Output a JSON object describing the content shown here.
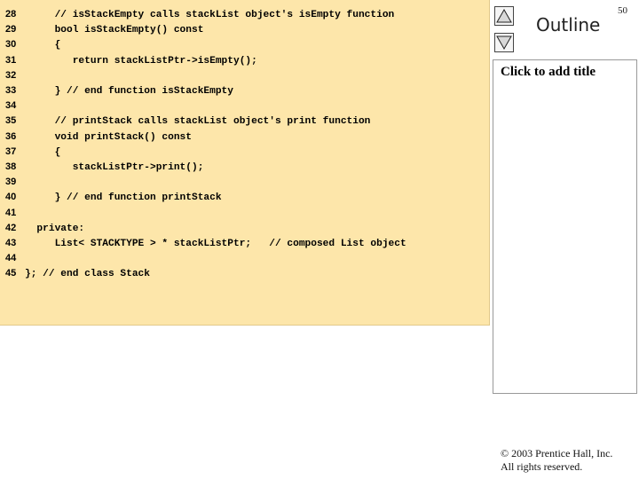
{
  "slide": {
    "number": "50",
    "outline_label": "Outline"
  },
  "code": {
    "lines": [
      {
        "n": "28",
        "text": "     // isStackEmpty calls stackList object's isEmpty function"
      },
      {
        "n": "29",
        "text": "     bool isStackEmpty() const"
      },
      {
        "n": "30",
        "text": "     {"
      },
      {
        "n": "31",
        "text": "        return stackListPtr->isEmpty();"
      },
      {
        "n": "32",
        "text": ""
      },
      {
        "n": "33",
        "text": "     } // end function isStackEmpty"
      },
      {
        "n": "34",
        "text": ""
      },
      {
        "n": "35",
        "text": "     // printStack calls stackList object's print function"
      },
      {
        "n": "36",
        "text": "     void printStack() const"
      },
      {
        "n": "37",
        "text": "     {"
      },
      {
        "n": "38",
        "text": "        stackListPtr->print();"
      },
      {
        "n": "39",
        "text": ""
      },
      {
        "n": "40",
        "text": "     } // end function printStack"
      },
      {
        "n": "41",
        "text": ""
      },
      {
        "n": "42",
        "text": "  private:"
      },
      {
        "n": "43",
        "text": "     List< STACKTYPE > * stackListPtr;   // composed List object"
      },
      {
        "n": "44",
        "text": ""
      },
      {
        "n": "45",
        "text": "}; // end class Stack"
      }
    ]
  },
  "notes": {
    "title": "Click to add title"
  },
  "footer": {
    "copyright_line1": "© 2003 Prentice Hall, Inc.",
    "copyright_line2": "All rights reserved."
  },
  "icons": {
    "up": "triangle-up-icon",
    "down": "triangle-down-icon"
  }
}
